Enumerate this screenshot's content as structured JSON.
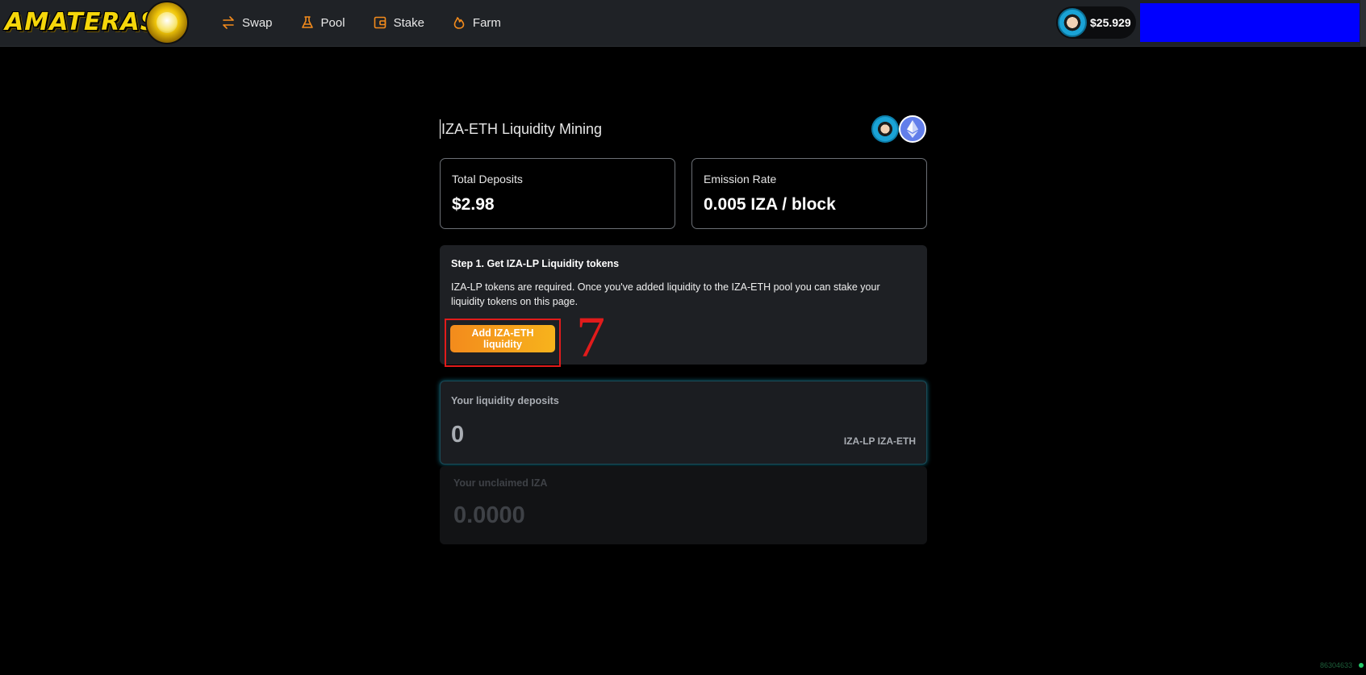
{
  "brand": {
    "logo_text": "AMATERASU"
  },
  "nav": {
    "items": [
      {
        "label": "Swap",
        "icon": "swap-arrows-icon"
      },
      {
        "label": "Pool",
        "icon": "flask-icon"
      },
      {
        "label": "Stake",
        "icon": "wallet-icon"
      },
      {
        "label": "Farm",
        "icon": "flame-icon"
      }
    ]
  },
  "wallet": {
    "balance": "$25.929",
    "avatar_icon": "iza-token-avatar-icon",
    "connect_box_color": "#0000ff"
  },
  "page": {
    "title": "IZA-ETH Liquidity Mining",
    "token_icons": [
      "iza-token-icon",
      "eth-token-icon"
    ]
  },
  "stats": {
    "total_deposits_label": "Total Deposits",
    "total_deposits_value": "$2.98",
    "emission_rate_label": "Emission Rate",
    "emission_rate_value": "0.005 IZA / block"
  },
  "step": {
    "title": "Step 1. Get IZA-LP Liquidity tokens",
    "description": "IZA-LP tokens are required. Once you've added liquidity to the IZA-ETH pool you can stake your liquidity tokens on this page.",
    "button_label": "Add IZA-ETH liquidity",
    "annotation_number": "7"
  },
  "deposits": {
    "label": "Your liquidity deposits",
    "value": "0",
    "unit": "IZA-LP IZA-ETH"
  },
  "unclaimed": {
    "label": "Your unclaimed IZA",
    "value": "0.0000"
  },
  "footer": {
    "corner_id": "86304633"
  },
  "colors": {
    "accent_orange": "#f38b1c",
    "annotation_red": "#e11b1b",
    "topbar": "#1f2226",
    "glow_teal": "#0f6a7e"
  }
}
